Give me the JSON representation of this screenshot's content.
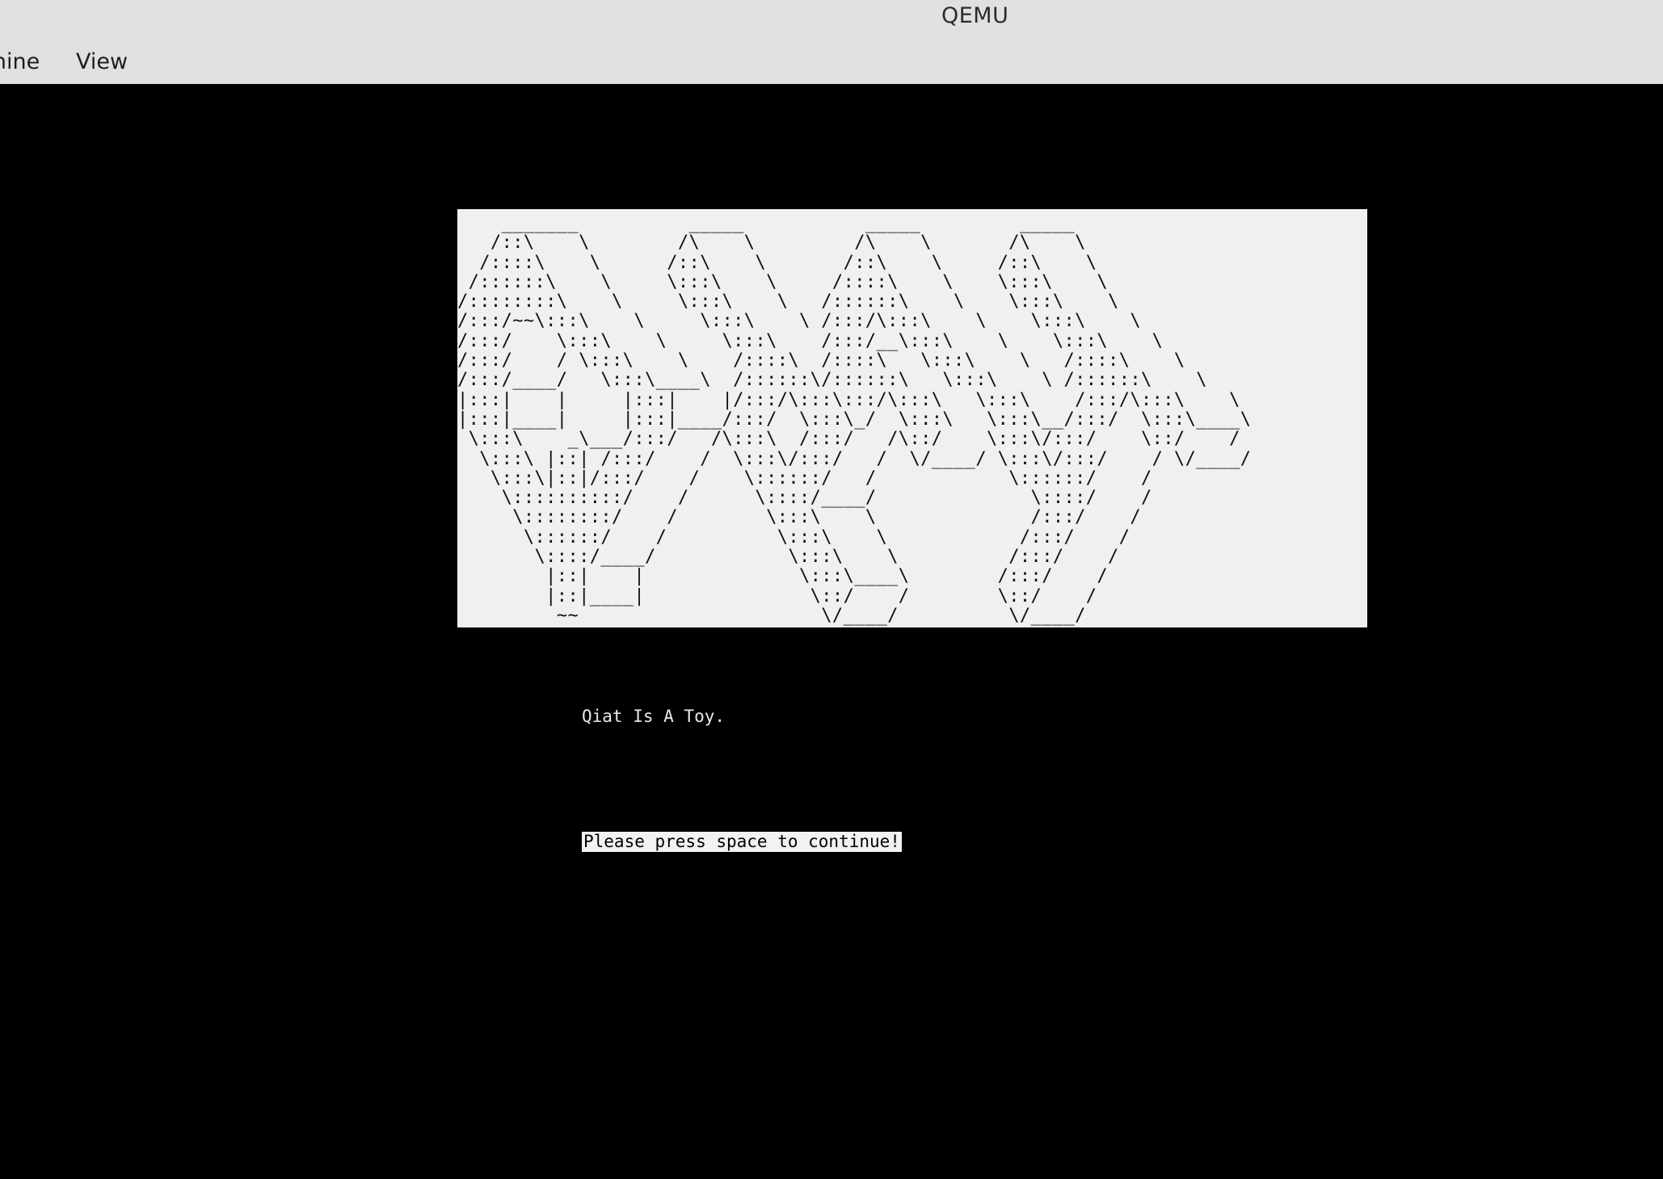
{
  "window": {
    "title": "QEMU"
  },
  "menubar": {
    "items": [
      {
        "label": "chine"
      },
      {
        "label": "View"
      }
    ]
  },
  "screen": {
    "banner_ascii": "    _______          _____           _____         _____\n   /::\\    \\        /\\    \\         /\\    \\       /\\    \\\n  /::::\\    \\      /::\\    \\       /::\\    \\     /::\\    \\\n /::::::\\    \\     \\:::\\    \\     /::::\\    \\    \\:::\\    \\\n/::::::::\\    \\     \\:::\\    \\   /::::::\\    \\    \\:::\\    \\\n/:::/~~\\:::\\    \\     \\:::\\    \\ /:::/\\:::\\    \\    \\:::\\    \\\n/:::/    \\:::\\    \\     \\:::\\    /:::/__\\:::\\    \\    \\:::\\    \\\n/:::/    / \\:::\\    \\    /::::\\  /::::\\   \\:::\\    \\   /::::\\    \\\n/:::/____/   \\:::\\____\\  /::::::\\/::::::\\   \\:::\\    \\ /::::::\\    \\\n|:::|    |     |:::|    |/:::/\\:::\\:::/\\:::\\   \\:::\\    /:::/\\:::\\    \\\n|:::|____|     |:::|____/:::/  \\:::\\_/  \\:::\\   \\:::\\__/:::/  \\:::\\____\\\n \\:::\\    _\\___/:::/   /\\:::\\  /:::/   /\\::/    \\:::\\/:::/    \\::/    /\n  \\:::\\ |::| /:::/    /  \\:::\\/:::/   /  \\/____/ \\:::\\/:::/    / \\/____/\n   \\:::\\|::|/:::/    /    \\::::::/   /            \\::::::/    /\n    \\::::::::::/    /      \\::::/____/              \\::::/    /\n     \\::::::::/    /        \\:::\\    \\              /:::/    /\n      \\::::::/    /          \\:::\\    \\            /:::/    /\n       \\::::/____/            \\:::\\    \\          /:::/    /\n        |::|    |              \\:::\\____\\        /:::/    /\n        |::|____|               \\::/    /        \\::/    /\n         ~~                      \\/____/          \\/____/",
    "tagline": "Qiat Is A Toy.",
    "prompt": "Please press space to continue!"
  }
}
